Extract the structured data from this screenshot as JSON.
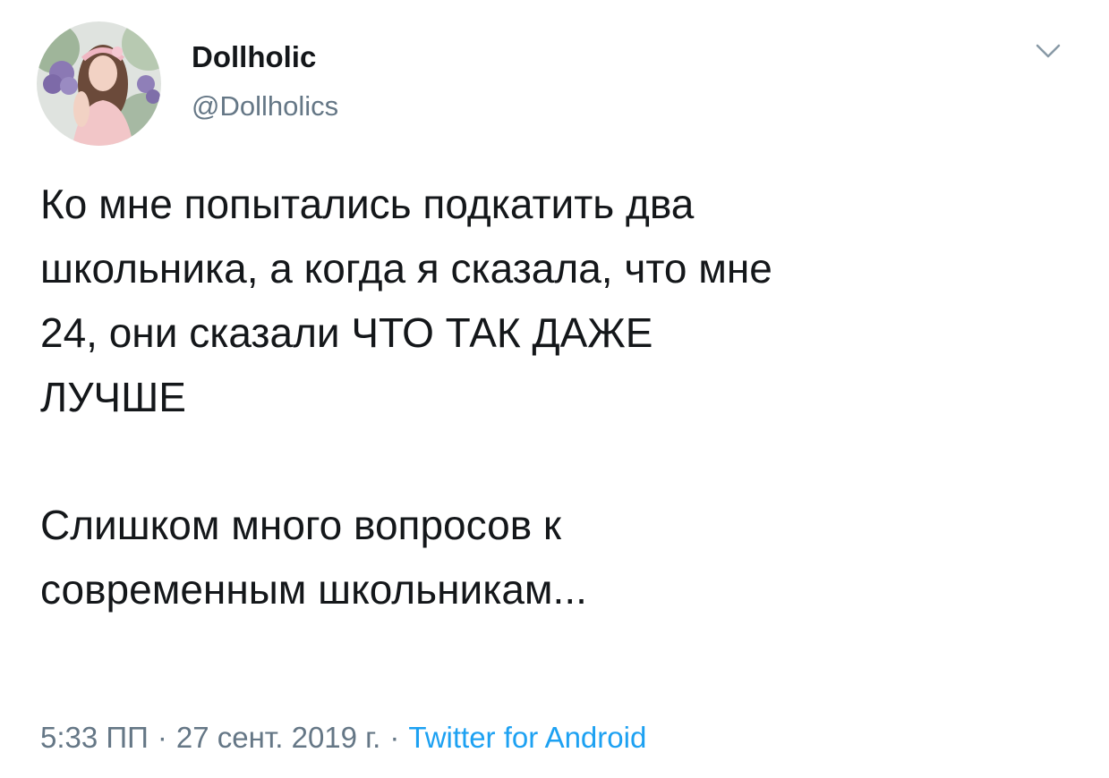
{
  "tweet": {
    "display_name": "Dollholic",
    "handle": "@Dollholics",
    "text_paragraphs": [
      "Ко мне попытались подкатить два\nшкольника, а когда я сказала, что мне\n24, они сказали ЧТО ТАК ДАЖЕ\nЛУЧШЕ",
      "Слишком много вопросов к\nсовременным школьникам..."
    ],
    "time": "5:33 ПП",
    "date": "27 сент. 2019 г.",
    "separator": "·",
    "source": "Twitter for Android"
  },
  "icons": {
    "menu": "chevron-down-icon"
  },
  "colors": {
    "text": "#14171a",
    "secondary": "#657786",
    "accent": "#1da1f2"
  }
}
